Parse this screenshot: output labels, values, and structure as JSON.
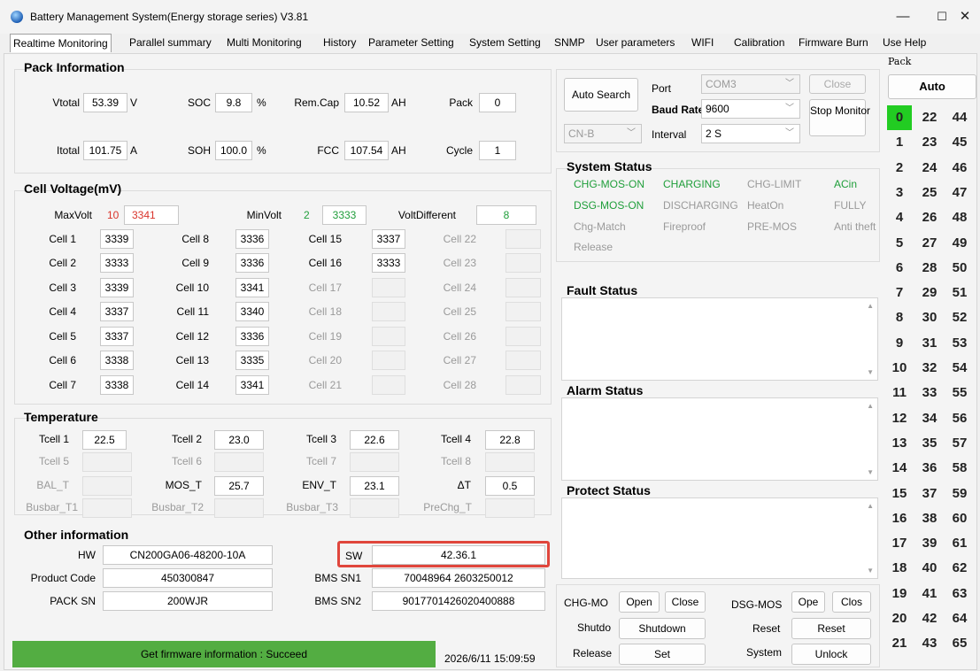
{
  "window": {
    "title": "Battery Management System(Energy storage series) V3.81",
    "min": "—",
    "max": "☐",
    "close": "✕"
  },
  "tabs": [
    "Realtime Monitoring",
    "Parallel summary",
    "Multi Monitoring",
    "History",
    "Parameter Setting",
    "System Setting",
    "SNMP",
    "User parameters",
    "WIFI",
    "Calibration",
    "Firmware Burn",
    "Use Help"
  ],
  "pack_info": {
    "title": "Pack Information",
    "vtotal_label": "Vtotal",
    "vtotal": "53.39",
    "vtotal_unit": "V",
    "soc_label": "SOC",
    "soc": "9.8",
    "soc_unit": "%",
    "remcap_label": "Rem.Cap",
    "remcap": "10.52",
    "remcap_unit": "AH",
    "pack_label": "Pack",
    "pack": "0",
    "itotal_label": "Itotal",
    "itotal": "101.75",
    "itotal_unit": "A",
    "soh_label": "SOH",
    "soh": "100.0",
    "soh_unit": "%",
    "fcc_label": "FCC",
    "fcc": "107.54",
    "fcc_unit": "AH",
    "cycle_label": "Cycle",
    "cycle": "1"
  },
  "cell_voltage": {
    "title": "Cell Voltage(mV)",
    "maxvolt_label": "MaxVolt",
    "maxvolt_cell": "10",
    "maxvolt": "3341",
    "minvolt_label": "MinVolt",
    "minvolt_cell": "2",
    "minvolt": "3333",
    "voltdiff_label": "VoltDifferent",
    "voltdiff": "8",
    "cells": [
      {
        "label": "Cell 1",
        "value": "3339"
      },
      {
        "label": "Cell 2",
        "value": "3333"
      },
      {
        "label": "Cell 3",
        "value": "3339"
      },
      {
        "label": "Cell 4",
        "value": "3337"
      },
      {
        "label": "Cell 5",
        "value": "3337"
      },
      {
        "label": "Cell 6",
        "value": "3338"
      },
      {
        "label": "Cell 7",
        "value": "3338"
      },
      {
        "label": "Cell 8",
        "value": "3336"
      },
      {
        "label": "Cell 9",
        "value": "3336"
      },
      {
        "label": "Cell 10",
        "value": "3341"
      },
      {
        "label": "Cell 11",
        "value": "3340"
      },
      {
        "label": "Cell 12",
        "value": "3336"
      },
      {
        "label": "Cell 13",
        "value": "3335"
      },
      {
        "label": "Cell 14",
        "value": "3341"
      },
      {
        "label": "Cell 15",
        "value": "3337"
      },
      {
        "label": "Cell 16",
        "value": "3333"
      },
      {
        "label": "Cell 17",
        "value": ""
      },
      {
        "label": "Cell 18",
        "value": ""
      },
      {
        "label": "Cell 19",
        "value": ""
      },
      {
        "label": "Cell 20",
        "value": ""
      },
      {
        "label": "Cell 21",
        "value": ""
      },
      {
        "label": "Cell 22",
        "value": ""
      },
      {
        "label": "Cell 23",
        "value": ""
      },
      {
        "label": "Cell 24",
        "value": ""
      },
      {
        "label": "Cell 25",
        "value": ""
      },
      {
        "label": "Cell 26",
        "value": ""
      },
      {
        "label": "Cell 27",
        "value": ""
      },
      {
        "label": "Cell 28",
        "value": ""
      }
    ]
  },
  "temperature": {
    "title": "Temperature",
    "tcell1_label": "Tcell 1",
    "tcell1": "22.5",
    "tcell2_label": "Tcell 2",
    "tcell2": "23.0",
    "tcell3_label": "Tcell 3",
    "tcell3": "22.6",
    "tcell4_label": "Tcell 4",
    "tcell4": "22.8",
    "tcell5_label": "Tcell 5",
    "tcell6_label": "Tcell 6",
    "tcell7_label": "Tcell 7",
    "tcell8_label": "Tcell 8",
    "bal_label": "BAL_T",
    "mos_label": "MOS_T",
    "mos": "25.7",
    "env_label": "ENV_T",
    "env": "23.1",
    "dt_label": "ΔT",
    "dt": "0.5",
    "busbar1_label": "Busbar_T1",
    "busbar2_label": "Busbar_T2",
    "busbar3_label": "Busbar_T3",
    "prechg_label": "PreChg_T"
  },
  "other_info": {
    "title": "Other information",
    "hw_label": "HW",
    "hw": "CN200GA06-48200-10A",
    "sw_label": "SW",
    "sw": "42.36.1",
    "product_code_label": "Product Code",
    "product_code": "450300847",
    "bms_sn1_label": "BMS SN1",
    "bms_sn1": "70048964 2603250012",
    "pack_sn_label": "PACK SN",
    "pack_sn": "200WJR",
    "bms_sn2_label": "BMS SN2",
    "bms_sn2": "9017701426020400888"
  },
  "connection": {
    "auto_search": "Auto Search",
    "port_label": "Port",
    "port": "COM3",
    "close": "Close",
    "baud_label": "Baud Rate",
    "baud": "9600",
    "stop_monitor": "Stop Monitor",
    "protocol": "CN-B",
    "interval_label": "Interval",
    "interval": "2 S"
  },
  "system_status": {
    "title": "System Status",
    "flags": [
      {
        "text": "CHG-MOS-ON",
        "active": true
      },
      {
        "text": "CHARGING",
        "active": true
      },
      {
        "text": "CHG-LIMIT",
        "active": false
      },
      {
        "text": "ACin",
        "active": true
      },
      {
        "text": "DSG-MOS-ON",
        "active": true
      },
      {
        "text": "DISCHARGING",
        "active": false
      },
      {
        "text": "HeatOn",
        "active": false
      },
      {
        "text": "FULLY",
        "active": false
      },
      {
        "text": "Chg-Match",
        "active": false
      },
      {
        "text": "Fireproof",
        "active": false
      },
      {
        "text": "PRE-MOS",
        "active": false
      },
      {
        "text": "Anti theft",
        "active": false
      },
      {
        "text": "Release",
        "active": false
      }
    ]
  },
  "fault_status": {
    "title": "Fault Status"
  },
  "alarm_status": {
    "title": "Alarm Status"
  },
  "protect_status": {
    "title": "Protect Status"
  },
  "controls": {
    "chg_mos_label": "CHG-MO",
    "open": "Open",
    "close": "Close",
    "dsg_mos_label": "DSG-MOS",
    "dsg_open": "Ope",
    "dsg_close": "Clos",
    "shutdown_label": "Shutdo",
    "shutdown": "Shutdown",
    "reset_label": "Reset",
    "reset": "Reset",
    "release_label": "Release",
    "set": "Set",
    "system_label": "System",
    "unlock": "Unlock"
  },
  "pack_panel": {
    "title": "Pack",
    "auto": "Auto",
    "selected": "0",
    "packs": [
      "0",
      "1",
      "2",
      "3",
      "4",
      "5",
      "6",
      "7",
      "8",
      "9",
      "10",
      "11",
      "12",
      "13",
      "14",
      "15",
      "16",
      "17",
      "18",
      "19",
      "20",
      "21",
      "22",
      "23",
      "24",
      "25",
      "26",
      "27",
      "28",
      "29",
      "30",
      "31",
      "32",
      "33",
      "34",
      "35",
      "36",
      "37",
      "38",
      "39",
      "40",
      "41",
      "42",
      "43",
      "44",
      "45",
      "46",
      "47",
      "48",
      "49",
      "50",
      "51",
      "52",
      "53",
      "54",
      "55",
      "56",
      "57",
      "58",
      "59",
      "60",
      "61",
      "62",
      "63",
      "64",
      "65"
    ]
  },
  "statusbar": {
    "message": "Get firmware information : Succeed",
    "datetime": "2026/6/11 15:09:59"
  },
  "colors": {
    "active_status": "#1f9e3a",
    "max_volt": "#d9342b",
    "min_volt": "#1f9e3a",
    "progress": "#53ad42",
    "highlight": "#e0463c",
    "selected_pack": "#22cc22"
  }
}
